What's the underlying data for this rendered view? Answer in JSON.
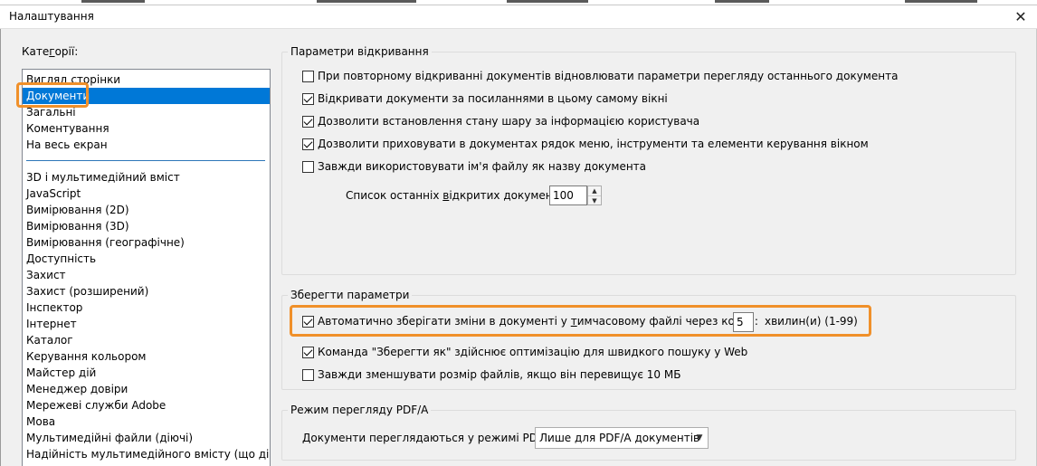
{
  "window": {
    "title": "Налаштування",
    "close_icon": "close-icon"
  },
  "categories": {
    "label": "Категорії:",
    "items_top": [
      "Вигляд сторінки",
      "Документи",
      "Загальні",
      "Коментування",
      "На весь екран"
    ],
    "items": [
      "3D і мультимедійний вміст",
      "JavaScript",
      "Вимірювання (2D)",
      "Вимірювання (3D)",
      "Вимірювання (географічне)",
      "Доступність",
      "Захист",
      "Захист (розширений)",
      "Інспектор",
      "Інтернет",
      "Каталог",
      "Керування кольором",
      "Майстер дій",
      "Менеджер довіри",
      "Мережеві служби Adobe",
      "Мова",
      "Мультимедійні файли (діючі)",
      "Надійність мультимедійного вмісту (що діє)"
    ],
    "selected": "Документи"
  },
  "open_settings": {
    "title": "Параметри відкривання",
    "options": [
      {
        "label": "При повторному відкриванні документів відновлювати параметри перегляду останнього документа",
        "checked": false
      },
      {
        "label": "Відкривати документи за посиланнями в цьому самому вікні",
        "checked": true
      },
      {
        "label": "Дозволити встановлення стану шару за інформацією користувача",
        "checked": true
      },
      {
        "label": "Дозволити приховувати в документах рядок меню, інструменти та елементи керування вікном",
        "checked": true
      },
      {
        "label": "Завжди використовувати ім'я файлу як назву документа",
        "checked": false
      }
    ],
    "recent_label": "Список останніх відкритих документів:",
    "recent_value": "100"
  },
  "save_settings": {
    "title": "Зберегти параметри",
    "autosave": {
      "label": "Автоматично зберігати зміни в документі у тимчасовому файлі через кожні:",
      "checked": true,
      "value": "5",
      "unit": "хвилин(и) (1-99)"
    },
    "options": [
      {
        "label": "Команда \"Зберегти як\" здійснює оптимізацію для швидкого пошуку у Web",
        "checked": true
      },
      {
        "label": "Завжди зменшувати розмір файлів, якщо він перевищує 10 МБ",
        "checked": false
      }
    ]
  },
  "pdfa": {
    "title": "Режим перегляду PDF/A",
    "label": "Документи переглядаються у режимі PDF/A:",
    "selected": "Лише для PDF/A документів"
  },
  "colors": {
    "selection": "#0078d7",
    "highlight": "#f0902a"
  }
}
